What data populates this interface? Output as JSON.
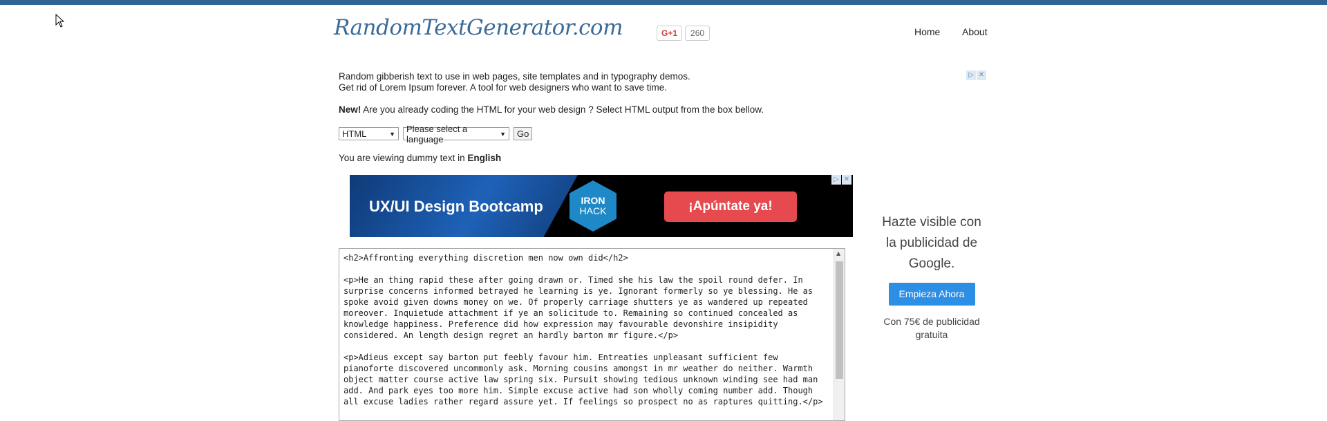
{
  "header": {
    "logo_text": "RandomTextGenerator.com",
    "gplus_label": "G+1",
    "gplus_count": "260",
    "nav": {
      "home": "Home",
      "about": "About"
    }
  },
  "intro": {
    "line1": "Random gibberish text to use in web pages, site templates and in typography demos.",
    "line2": "Get rid of Lorem Ipsum forever. A tool for web designers who want to save time.",
    "new_label": "New!",
    "new_text": " Are you already coding the HTML for your web design ? Select HTML output from the box bellow."
  },
  "controls": {
    "format_selected": "HTML",
    "language_selected": "Please select a language",
    "go_label": "Go"
  },
  "viewing": {
    "prefix": "You are viewing dummy text in ",
    "language": "English"
  },
  "banner_ad": {
    "title": "UX/UI Design Bootcamp",
    "brand_line1": "IRON",
    "brand_line2": "HACK",
    "cta": "¡Apúntate ya!"
  },
  "ad_choices": {
    "play_icon": "▷",
    "close_icon": "✕"
  },
  "output_text": "<h2>Affronting everything discretion men now own did</h2>\n\n<p>He an thing rapid these after going drawn or. Timed she his law the spoil round defer. In surprise concerns informed betrayed he learning is ye. Ignorant formerly so ye blessing. He as spoke avoid given downs money on we. Of properly carriage shutters ye as wandered up repeated moreover. Inquietude attachment if ye an solicitude to. Remaining so continued concealed as knowledge happiness. Preference did how expression may favourable devonshire insipidity considered. An length design regret an hardly barton mr figure.</p>\n\n<p>Adieus except say barton put feebly favour him. Entreaties unpleasant sufficient few pianoforte discovered uncommonly ask. Morning cousins amongst in mr weather do neither. Warmth object matter course active law spring six. Pursuit showing tedious unknown winding see had man add. And park eyes too more him. Simple excuse active had son wholly coming number add. Though all excuse ladies rather regard assure yet. If feelings so prospect no as raptures quitting.</p>",
  "side_ad": {
    "headline": "Hazte visible con la publicidad de Google.",
    "button": "Empieza Ahora",
    "sub": "Con 75€ de publicidad gratuita"
  }
}
